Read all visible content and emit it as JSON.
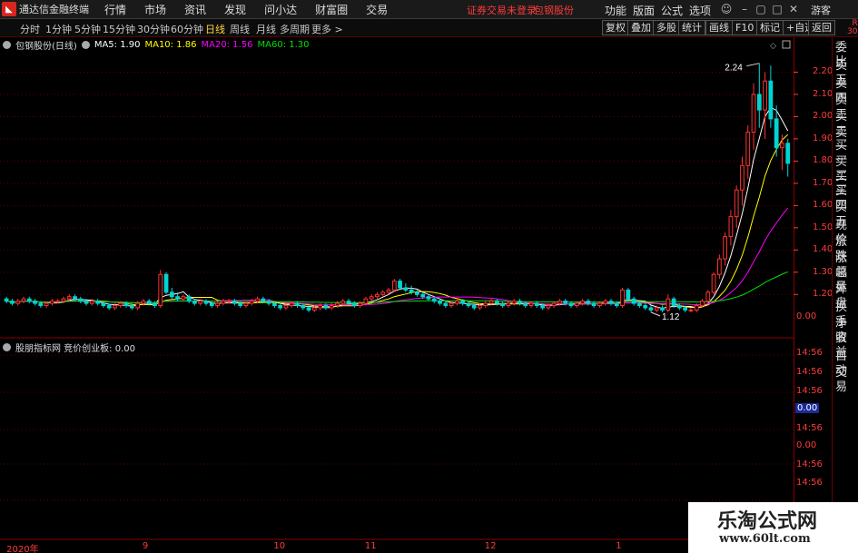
{
  "app": {
    "title": "通达信金融终端",
    "notice": "证券交易未登录",
    "stock_name": "包钢股份",
    "guest": "游客"
  },
  "menu": [
    "行情",
    "市场",
    "资讯",
    "发现",
    "问小达",
    "财富圈",
    "交易"
  ],
  "right_menu": [
    "功能",
    "版面",
    "公式",
    "选项"
  ],
  "periods": [
    "分时",
    "1分钟",
    "5分钟",
    "15分钟",
    "30分钟",
    "60分钟",
    "日线",
    "周线",
    "月线",
    "多周期",
    "更多 >"
  ],
  "active_period": "日线",
  "toolbar_buttons": [
    "复权",
    "叠加",
    "多股",
    "统计",
    "画线",
    "F10",
    "标记",
    "+自选",
    "返回"
  ],
  "legend": {
    "title": "包钢股份(日线)",
    "ma": [
      {
        "label": "MA5: 1.90",
        "color": "#ffffff"
      },
      {
        "label": "MA10: 1.86",
        "color": "#ffff00"
      },
      {
        "label": "MA20: 1.56",
        "color": "#ff00ff"
      },
      {
        "label": "MA60: 1.30",
        "color": "#00e000"
      }
    ]
  },
  "sub_legend": {
    "title": "股朋指标网 竞价创业板: 0.00"
  },
  "side_panel": [
    "委比",
    "卖五",
    "卖四",
    "卖三",
    "卖二",
    "卖一",
    "买一",
    "买二",
    "买三",
    "买四",
    "买五",
    "现价",
    "涨跌",
    "涨幅",
    "总量",
    "外盘",
    "换手",
    "净资",
    "收益",
    "自动",
    "交易"
  ],
  "side_r": {
    "top": "R",
    "bottom": "300"
  },
  "watermark": {
    "title": "乐淘公式网",
    "url": "www.60lt.com"
  },
  "annotations": {
    "high": "2.24",
    "low": "1.12"
  },
  "right_axis": {
    "sub_labels": [
      "0.00",
      "14:56",
      "14:56",
      "14:56",
      "0.00",
      "14:56",
      "0.00",
      "14:56",
      "14:56"
    ],
    "highlight_value": "0.00"
  },
  "chart_data": {
    "type": "candlestick",
    "title": "包钢股份(日线)",
    "ylim": [
      1.05,
      2.3
    ],
    "y_ticks": [
      1.2,
      1.3,
      1.4,
      1.5,
      1.6,
      1.7,
      1.8,
      1.9,
      2.0,
      2.1,
      2.2
    ],
    "x_ticks": [
      {
        "label": "2020年",
        "index": 0
      },
      {
        "label": "9",
        "index": 24
      },
      {
        "label": "10",
        "index": 47
      },
      {
        "label": "11",
        "index": 63
      },
      {
        "label": "12",
        "index": 84
      },
      {
        "label": "1",
        "index": 107
      },
      {
        "label": "2",
        "index": 127
      }
    ],
    "ohlc": [
      [
        1.18,
        1.19,
        1.16,
        1.17
      ],
      [
        1.17,
        1.18,
        1.15,
        1.16
      ],
      [
        1.16,
        1.18,
        1.15,
        1.17
      ],
      [
        1.17,
        1.19,
        1.16,
        1.18
      ],
      [
        1.18,
        1.19,
        1.16,
        1.17
      ],
      [
        1.17,
        1.18,
        1.15,
        1.16
      ],
      [
        1.16,
        1.17,
        1.14,
        1.15
      ],
      [
        1.15,
        1.17,
        1.14,
        1.16
      ],
      [
        1.16,
        1.18,
        1.15,
        1.17
      ],
      [
        1.17,
        1.18,
        1.16,
        1.17
      ],
      [
        1.17,
        1.19,
        1.16,
        1.18
      ],
      [
        1.18,
        1.2,
        1.17,
        1.19
      ],
      [
        1.19,
        1.2,
        1.17,
        1.18
      ],
      [
        1.18,
        1.19,
        1.16,
        1.17
      ],
      [
        1.17,
        1.18,
        1.15,
        1.16
      ],
      [
        1.16,
        1.18,
        1.15,
        1.17
      ],
      [
        1.17,
        1.18,
        1.15,
        1.16
      ],
      [
        1.16,
        1.17,
        1.14,
        1.15
      ],
      [
        1.15,
        1.16,
        1.13,
        1.14
      ],
      [
        1.14,
        1.16,
        1.13,
        1.15
      ],
      [
        1.15,
        1.17,
        1.14,
        1.16
      ],
      [
        1.16,
        1.17,
        1.14,
        1.15
      ],
      [
        1.15,
        1.16,
        1.13,
        1.14
      ],
      [
        1.14,
        1.17,
        1.13,
        1.16
      ],
      [
        1.16,
        1.18,
        1.15,
        1.17
      ],
      [
        1.17,
        1.18,
        1.15,
        1.16
      ],
      [
        1.16,
        1.17,
        1.14,
        1.15
      ],
      [
        1.15,
        1.31,
        1.14,
        1.29
      ],
      [
        1.29,
        1.3,
        1.2,
        1.21
      ],
      [
        1.21,
        1.23,
        1.18,
        1.19
      ],
      [
        1.19,
        1.21,
        1.17,
        1.18
      ],
      [
        1.18,
        1.2,
        1.17,
        1.19
      ],
      [
        1.19,
        1.2,
        1.16,
        1.17
      ],
      [
        1.17,
        1.18,
        1.15,
        1.16
      ],
      [
        1.16,
        1.18,
        1.15,
        1.17
      ],
      [
        1.17,
        1.18,
        1.15,
        1.16
      ],
      [
        1.16,
        1.17,
        1.14,
        1.15
      ],
      [
        1.15,
        1.17,
        1.14,
        1.16
      ],
      [
        1.16,
        1.18,
        1.15,
        1.17
      ],
      [
        1.17,
        1.18,
        1.16,
        1.17
      ],
      [
        1.17,
        1.18,
        1.15,
        1.16
      ],
      [
        1.16,
        1.17,
        1.14,
        1.15
      ],
      [
        1.15,
        1.17,
        1.14,
        1.16
      ],
      [
        1.16,
        1.18,
        1.15,
        1.17
      ],
      [
        1.17,
        1.19,
        1.16,
        1.18
      ],
      [
        1.18,
        1.19,
        1.16,
        1.17
      ],
      [
        1.17,
        1.18,
        1.15,
        1.16
      ],
      [
        1.16,
        1.17,
        1.14,
        1.15
      ],
      [
        1.15,
        1.16,
        1.13,
        1.14
      ],
      [
        1.14,
        1.16,
        1.13,
        1.15
      ],
      [
        1.15,
        1.17,
        1.14,
        1.16
      ],
      [
        1.16,
        1.17,
        1.14,
        1.15
      ],
      [
        1.15,
        1.16,
        1.13,
        1.14
      ],
      [
        1.14,
        1.15,
        1.12,
        1.13
      ],
      [
        1.13,
        1.15,
        1.12,
        1.14
      ],
      [
        1.14,
        1.16,
        1.13,
        1.15
      ],
      [
        1.15,
        1.16,
        1.13,
        1.14
      ],
      [
        1.14,
        1.16,
        1.13,
        1.15
      ],
      [
        1.15,
        1.17,
        1.14,
        1.16
      ],
      [
        1.16,
        1.18,
        1.15,
        1.17
      ],
      [
        1.17,
        1.18,
        1.15,
        1.16
      ],
      [
        1.16,
        1.17,
        1.14,
        1.15
      ],
      [
        1.15,
        1.17,
        1.14,
        1.16
      ],
      [
        1.16,
        1.19,
        1.15,
        1.18
      ],
      [
        1.18,
        1.2,
        1.17,
        1.19
      ],
      [
        1.19,
        1.21,
        1.18,
        1.2
      ],
      [
        1.2,
        1.22,
        1.19,
        1.21
      ],
      [
        1.21,
        1.23,
        1.2,
        1.22
      ],
      [
        1.22,
        1.27,
        1.21,
        1.26
      ],
      [
        1.26,
        1.27,
        1.22,
        1.23
      ],
      [
        1.23,
        1.25,
        1.21,
        1.22
      ],
      [
        1.22,
        1.24,
        1.2,
        1.21
      ],
      [
        1.21,
        1.22,
        1.19,
        1.2
      ],
      [
        1.2,
        1.21,
        1.18,
        1.19
      ],
      [
        1.19,
        1.2,
        1.17,
        1.18
      ],
      [
        1.18,
        1.19,
        1.16,
        1.17
      ],
      [
        1.17,
        1.18,
        1.15,
        1.16
      ],
      [
        1.16,
        1.17,
        1.14,
        1.15
      ],
      [
        1.15,
        1.17,
        1.14,
        1.16
      ],
      [
        1.16,
        1.18,
        1.15,
        1.17
      ],
      [
        1.17,
        1.18,
        1.15,
        1.16
      ],
      [
        1.16,
        1.17,
        1.14,
        1.15
      ],
      [
        1.15,
        1.16,
        1.13,
        1.14
      ],
      [
        1.14,
        1.16,
        1.13,
        1.15
      ],
      [
        1.15,
        1.17,
        1.14,
        1.16
      ],
      [
        1.16,
        1.18,
        1.15,
        1.17
      ],
      [
        1.17,
        1.18,
        1.15,
        1.16
      ],
      [
        1.16,
        1.17,
        1.14,
        1.15
      ],
      [
        1.15,
        1.17,
        1.14,
        1.16
      ],
      [
        1.16,
        1.18,
        1.15,
        1.17
      ],
      [
        1.17,
        1.18,
        1.15,
        1.16
      ],
      [
        1.16,
        1.17,
        1.14,
        1.15
      ],
      [
        1.15,
        1.17,
        1.14,
        1.16
      ],
      [
        1.16,
        1.17,
        1.14,
        1.15
      ],
      [
        1.15,
        1.16,
        1.13,
        1.14
      ],
      [
        1.14,
        1.16,
        1.13,
        1.15
      ],
      [
        1.15,
        1.17,
        1.14,
        1.16
      ],
      [
        1.16,
        1.18,
        1.15,
        1.17
      ],
      [
        1.17,
        1.18,
        1.15,
        1.16
      ],
      [
        1.16,
        1.17,
        1.14,
        1.15
      ],
      [
        1.15,
        1.17,
        1.14,
        1.16
      ],
      [
        1.16,
        1.18,
        1.15,
        1.17
      ],
      [
        1.17,
        1.18,
        1.15,
        1.16
      ],
      [
        1.16,
        1.17,
        1.14,
        1.15
      ],
      [
        1.15,
        1.17,
        1.14,
        1.16
      ],
      [
        1.16,
        1.18,
        1.15,
        1.17
      ],
      [
        1.17,
        1.18,
        1.15,
        1.16
      ],
      [
        1.16,
        1.17,
        1.14,
        1.15
      ],
      [
        1.15,
        1.23,
        1.14,
        1.22
      ],
      [
        1.22,
        1.23,
        1.17,
        1.18
      ],
      [
        1.18,
        1.19,
        1.15,
        1.16
      ],
      [
        1.16,
        1.17,
        1.14,
        1.15
      ],
      [
        1.15,
        1.16,
        1.13,
        1.14
      ],
      [
        1.14,
        1.15,
        1.12,
        1.13
      ],
      [
        1.13,
        1.15,
        1.12,
        1.14
      ],
      [
        1.14,
        1.15,
        1.12,
        1.13
      ],
      [
        1.13,
        1.2,
        1.12,
        1.18
      ],
      [
        1.18,
        1.19,
        1.14,
        1.15
      ],
      [
        1.15,
        1.16,
        1.13,
        1.14
      ],
      [
        1.14,
        1.15,
        1.12,
        1.13
      ],
      [
        1.13,
        1.14,
        1.12,
        1.13
      ],
      [
        1.13,
        1.16,
        1.12,
        1.15
      ],
      [
        1.15,
        1.18,
        1.14,
        1.17
      ],
      [
        1.17,
        1.22,
        1.16,
        1.21
      ],
      [
        1.21,
        1.3,
        1.2,
        1.29
      ],
      [
        1.29,
        1.38,
        1.27,
        1.36
      ],
      [
        1.36,
        1.48,
        1.33,
        1.46
      ],
      [
        1.46,
        1.58,
        1.42,
        1.55
      ],
      [
        1.55,
        1.69,
        1.5,
        1.67
      ],
      [
        1.67,
        1.82,
        1.6,
        1.78
      ],
      [
        1.78,
        1.96,
        1.72,
        1.93
      ],
      [
        1.93,
        2.15,
        1.85,
        2.1
      ],
      [
        2.1,
        2.24,
        1.95,
        2.03
      ],
      [
        2.03,
        2.2,
        1.9,
        2.16
      ],
      [
        2.16,
        2.23,
        1.95,
        1.99
      ],
      [
        1.99,
        2.05,
        1.82,
        1.86
      ],
      [
        1.86,
        1.92,
        1.76,
        1.88
      ],
      [
        1.88,
        1.9,
        1.73,
        1.79
      ]
    ],
    "series": [
      {
        "name": "MA5",
        "color": "#ffffff"
      },
      {
        "name": "MA10",
        "color": "#ffff00"
      },
      {
        "name": "MA20",
        "color": "#ff00ff"
      },
      {
        "name": "MA60",
        "color": "#00e000"
      }
    ]
  }
}
